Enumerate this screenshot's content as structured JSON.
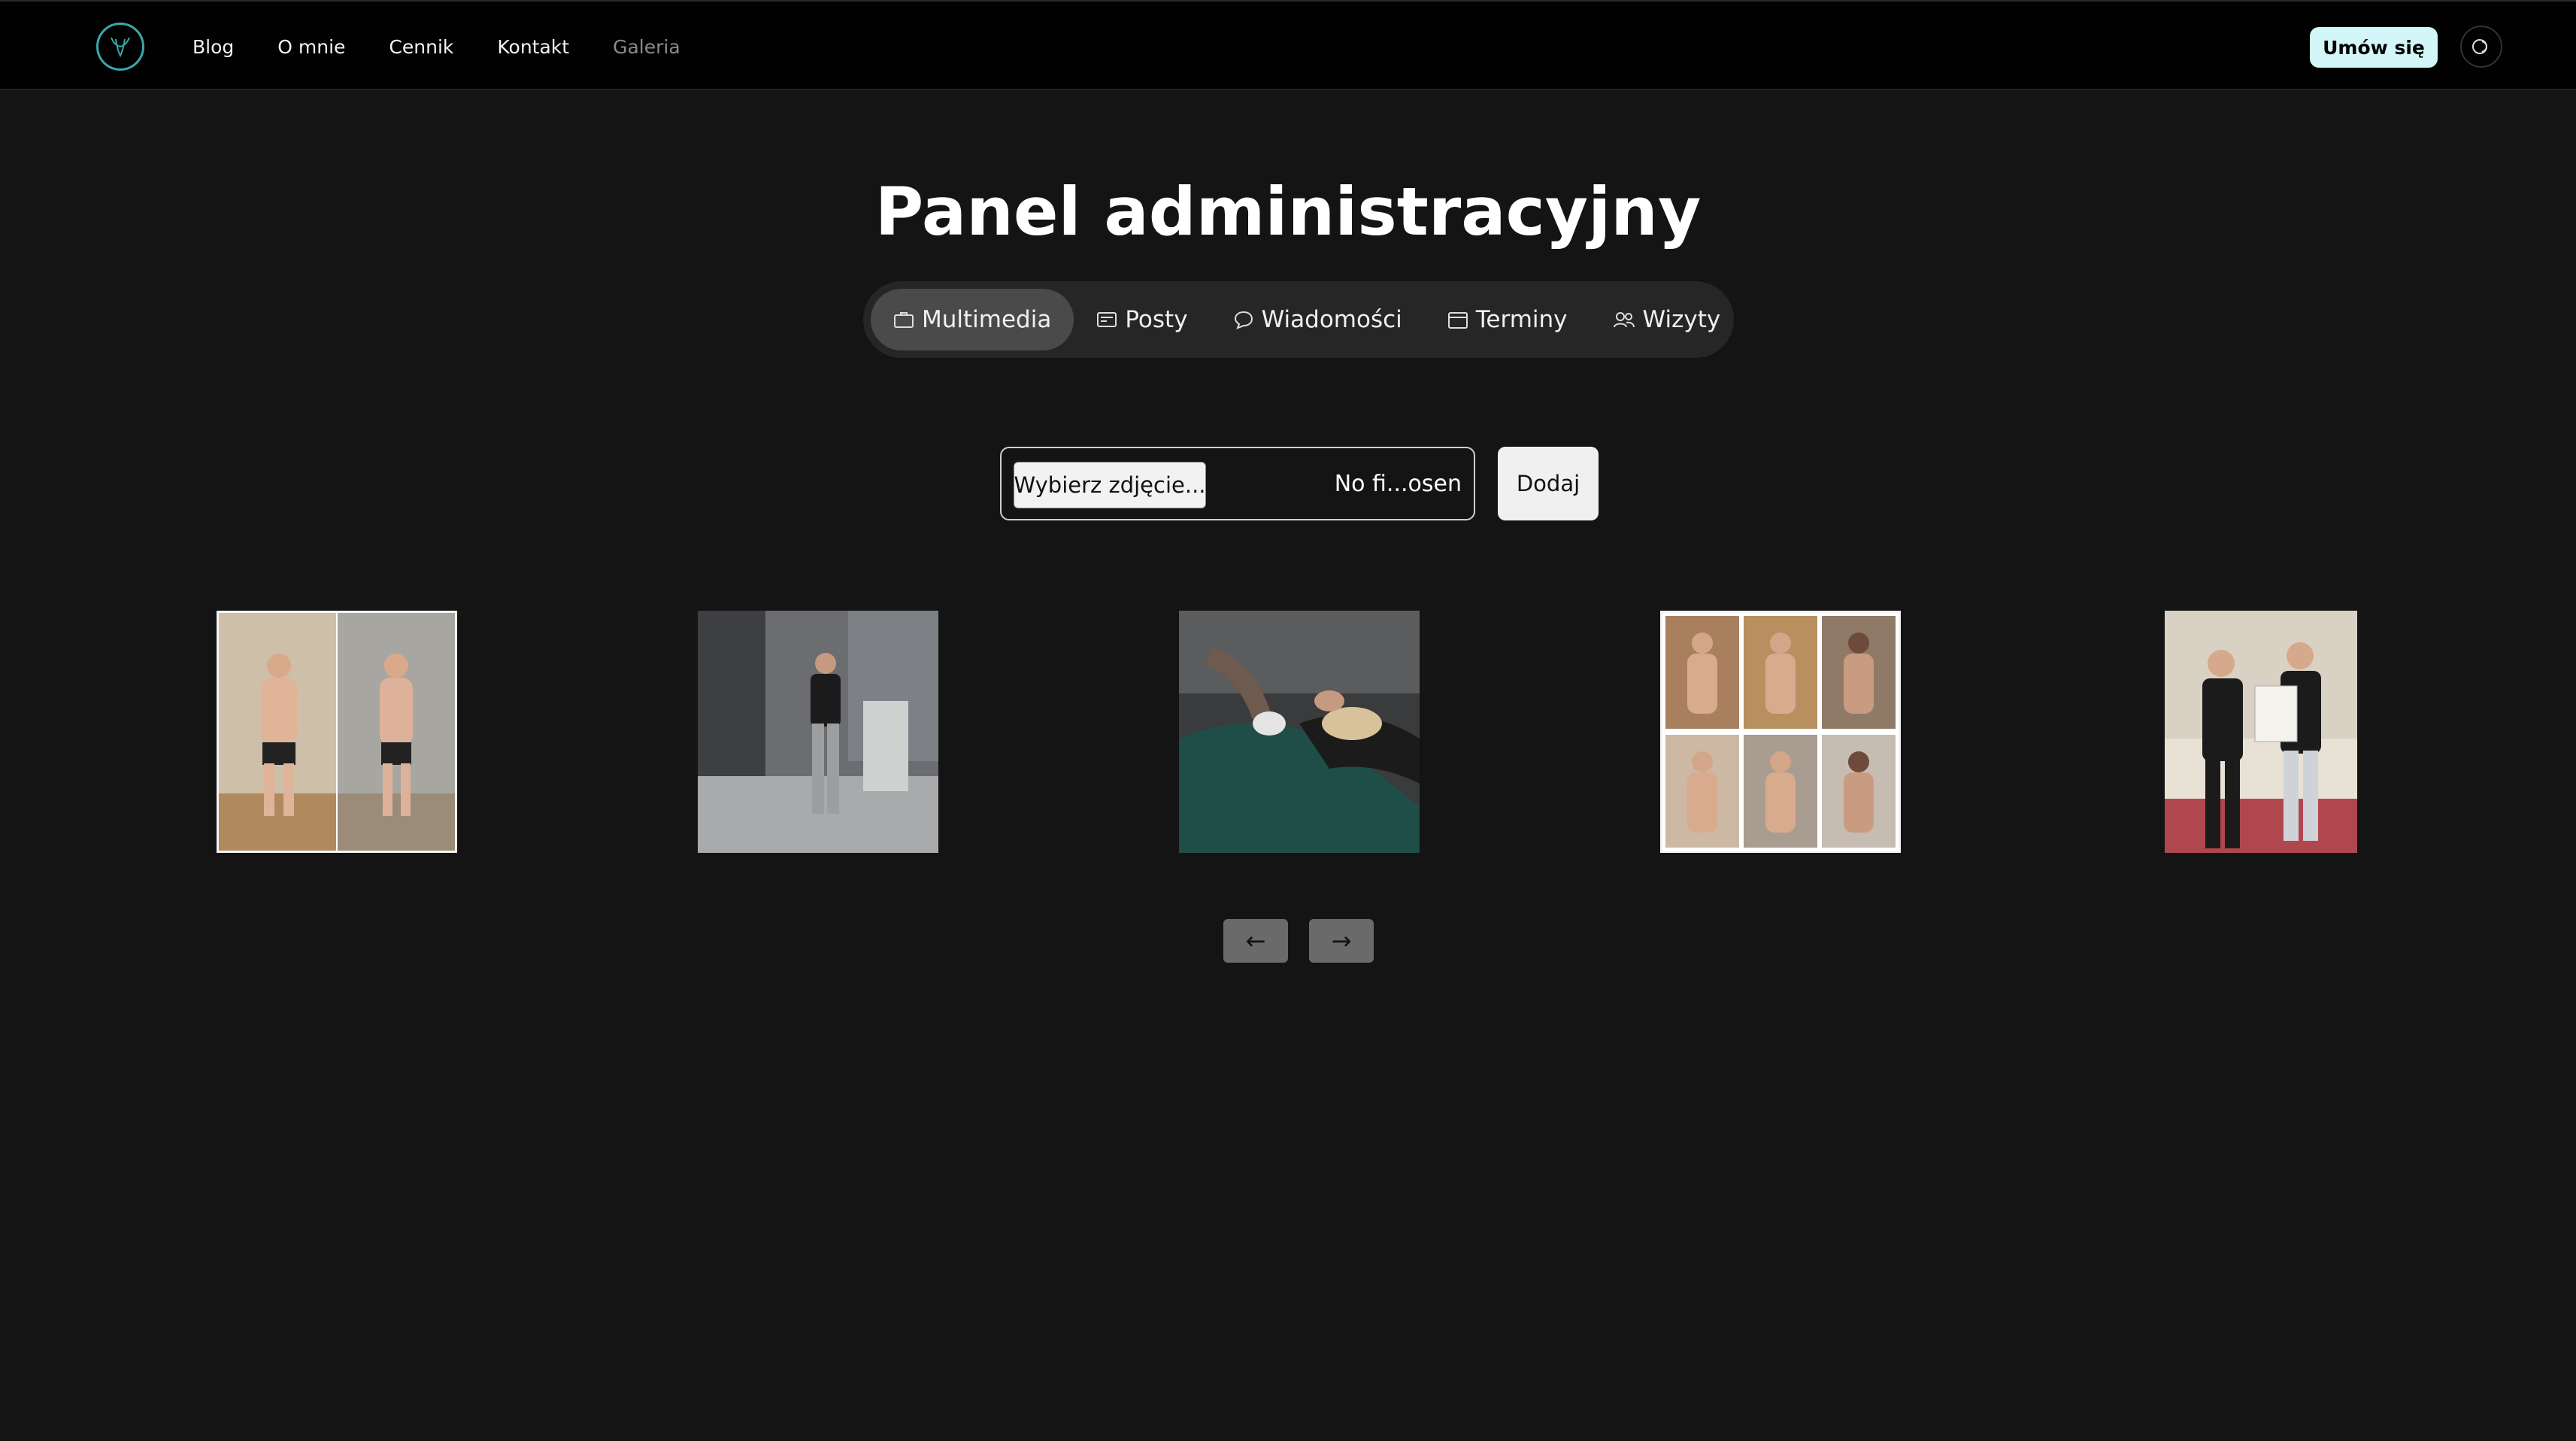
{
  "nav": {
    "logo_icon": "deer-head-logo-icon",
    "links": [
      {
        "label": "Blog"
      },
      {
        "label": "O mnie"
      },
      {
        "label": "Cennik"
      },
      {
        "label": "Kontakt"
      },
      {
        "label": "Galeria"
      }
    ],
    "cta_label": "Umów się",
    "theme_icon": "theme-toggle-icon"
  },
  "page": {
    "title": "Panel administracyjny"
  },
  "tabs": [
    {
      "label": "Multimedia",
      "icon": "briefcase-icon",
      "active": true
    },
    {
      "label": "Posty",
      "icon": "newspaper-icon",
      "active": false
    },
    {
      "label": "Wiadomości",
      "icon": "chat-bubble-icon",
      "active": false
    },
    {
      "label": "Terminy",
      "icon": "calendar-icon",
      "active": false
    },
    {
      "label": "Wizyty",
      "icon": "users-icon",
      "active": false
    }
  ],
  "upload": {
    "choose_label": "Wybierz zdjęcie...",
    "status_text": "No fi...osen",
    "add_label": "Dodaj"
  },
  "gallery": {
    "images": [
      {
        "alt": "before-after-photo"
      },
      {
        "alt": "trainer-on-stairs-photo"
      },
      {
        "alt": "massage-therapy-photo"
      },
      {
        "alt": "progress-collage-photo"
      },
      {
        "alt": "certificate-handshake-photo"
      }
    ]
  },
  "pagination": {
    "prev_label": "←",
    "next_label": "→"
  },
  "colors": {
    "background": "#141414",
    "navbar": "#010101",
    "accent_cta": "#d3f6f8",
    "tab_active": "#4a4a4a",
    "tabs_bg": "#262626"
  }
}
